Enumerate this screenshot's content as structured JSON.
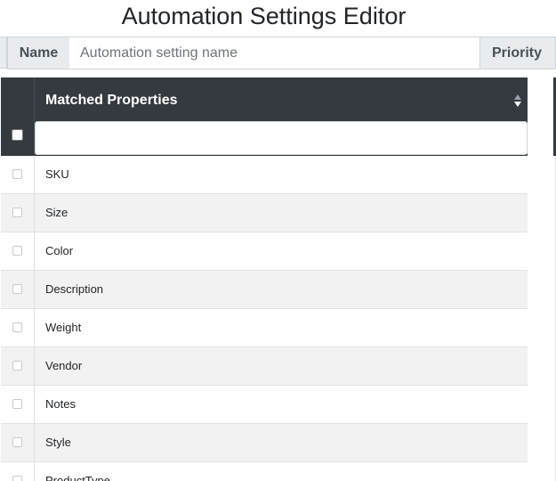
{
  "page": {
    "title": "Automation Settings Editor"
  },
  "form": {
    "name_label": "Name",
    "name_placeholder": "Automation setting name",
    "name_value": "",
    "priority_label": "Priority"
  },
  "grid": {
    "column_header": "Matched Properties",
    "sort_icon": "sort-arrows-icon",
    "filter_value": "",
    "rows": [
      {
        "label": "SKU",
        "checked": false
      },
      {
        "label": "Size",
        "checked": false
      },
      {
        "label": "Color",
        "checked": false
      },
      {
        "label": "Description",
        "checked": false
      },
      {
        "label": "Weight",
        "checked": false
      },
      {
        "label": "Vendor",
        "checked": false
      },
      {
        "label": "Notes",
        "checked": false
      },
      {
        "label": "Style",
        "checked": false
      },
      {
        "label": "ProductType",
        "checked": false
      }
    ]
  },
  "colors": {
    "header_bg": "#343a40",
    "row_alt_bg": "#f2f2f2",
    "input_group_bg": "#e9ecef"
  }
}
